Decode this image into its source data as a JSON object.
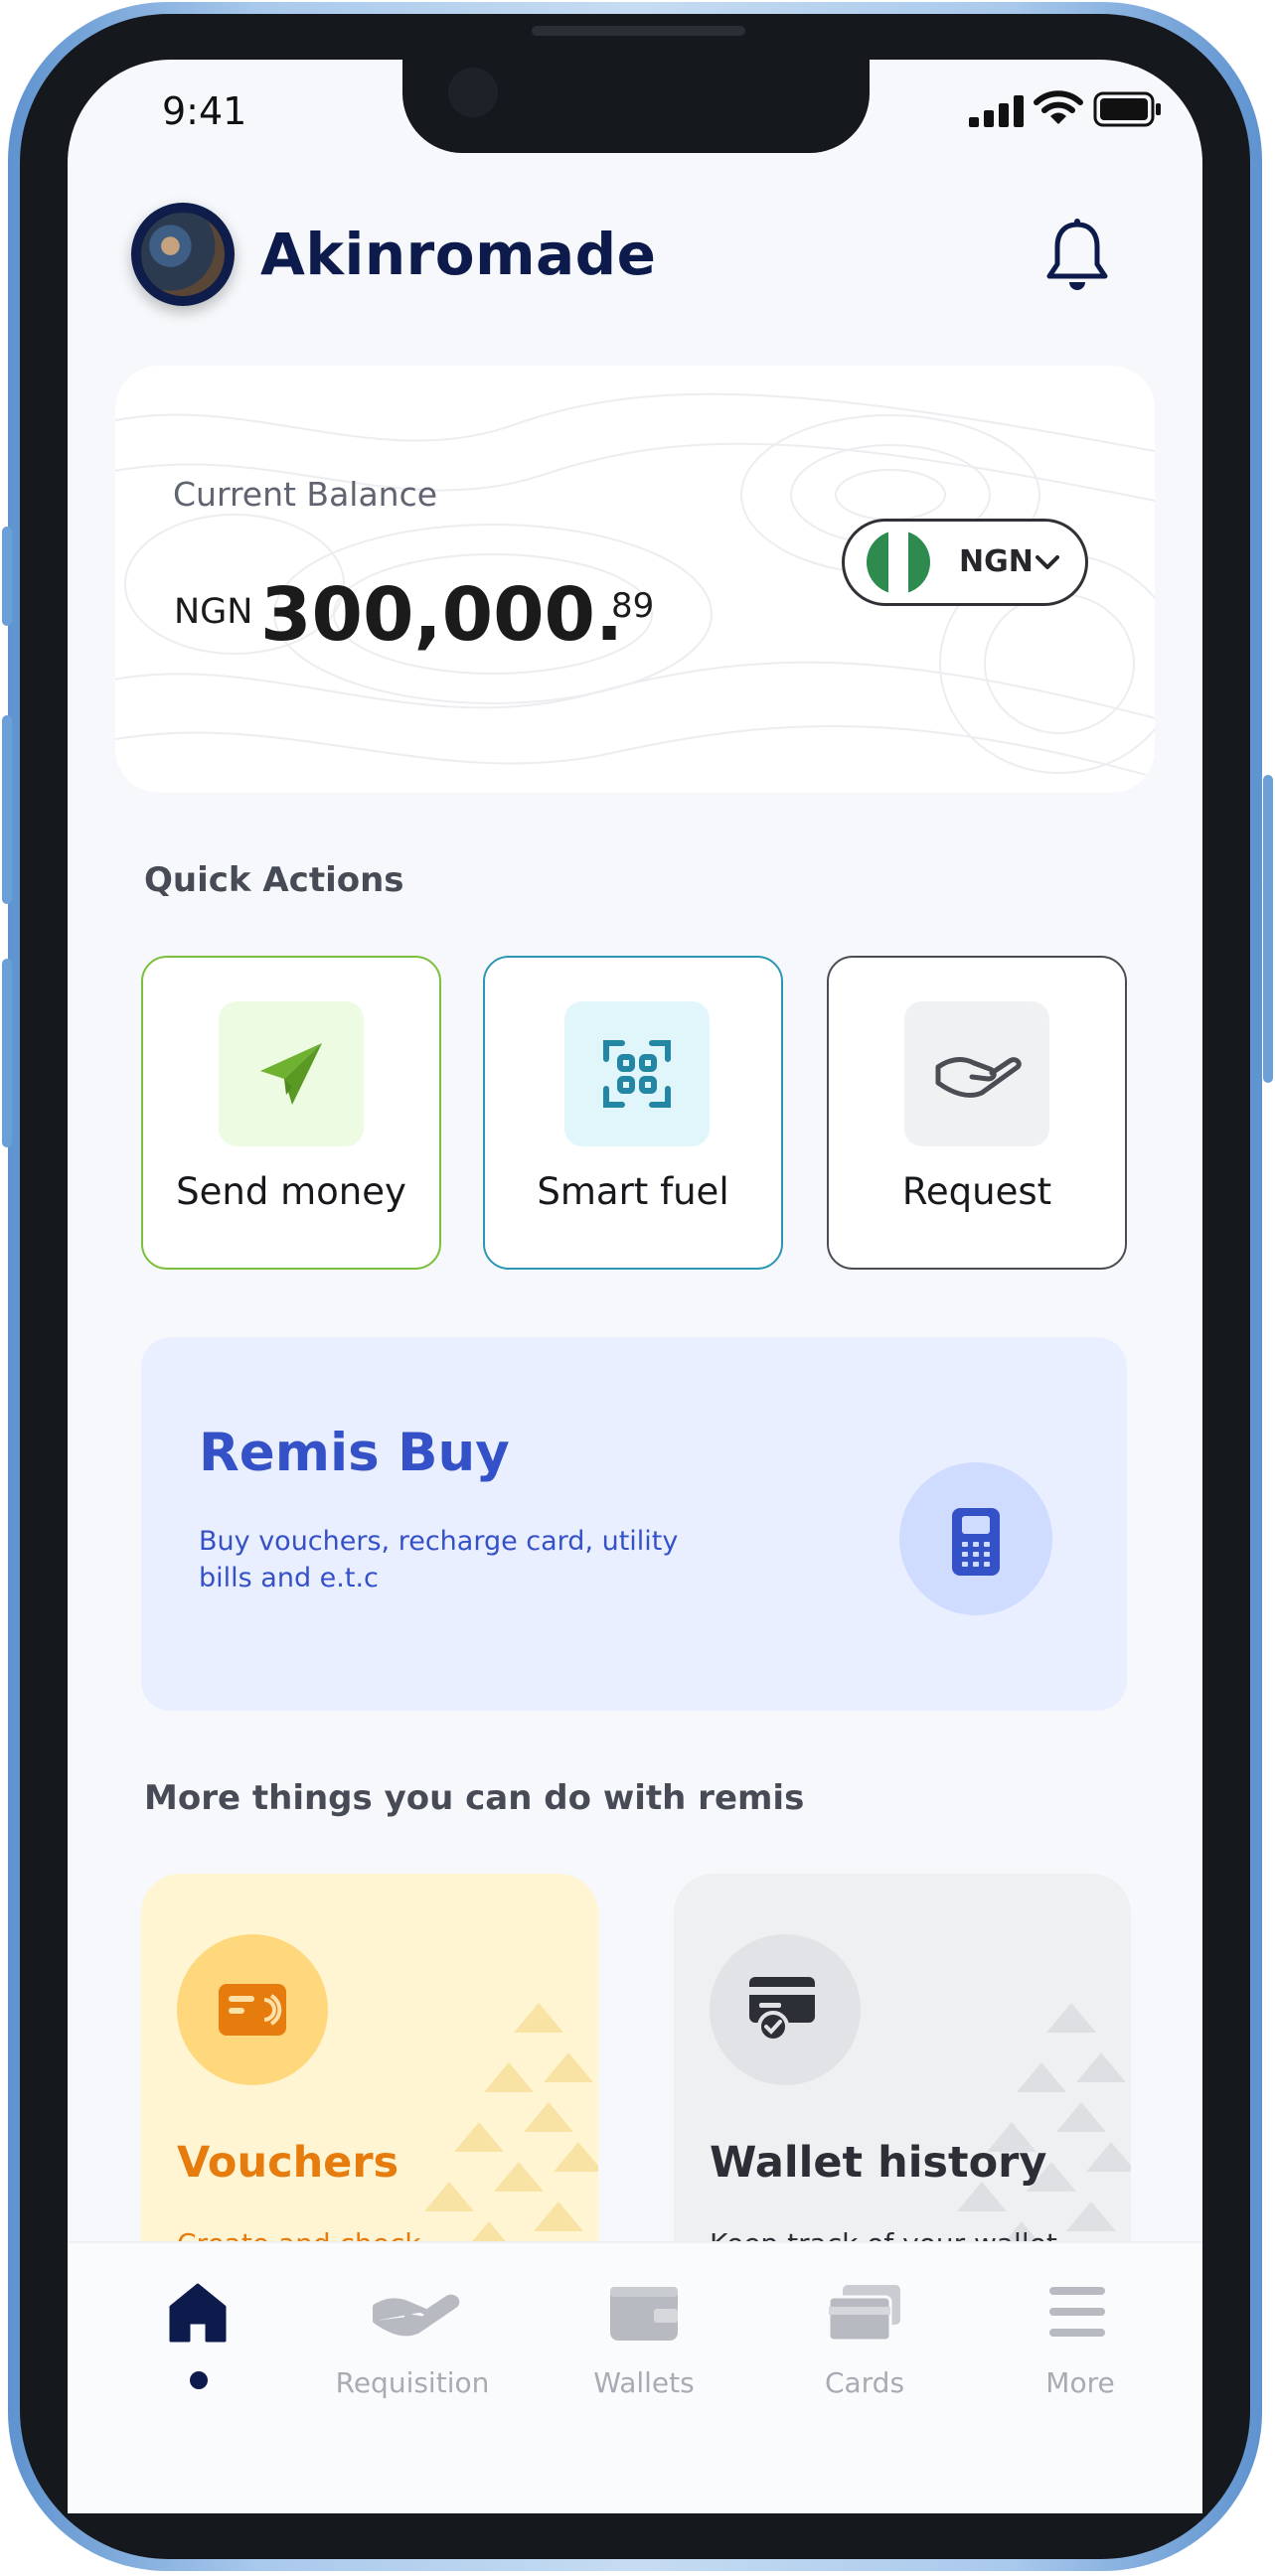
{
  "status_bar": {
    "time": "9:41"
  },
  "header": {
    "username": "Akinromade"
  },
  "balance": {
    "label": "Current Balance",
    "currency_prefix": "NGN",
    "amount_main": "300,000.",
    "amount_decimal": "89",
    "currency_selector": "NGN"
  },
  "quick_actions": {
    "title": "Quick Actions",
    "items": [
      {
        "label": "Send money",
        "accent": "#7cbf3c",
        "icon": "paper-plane-icon"
      },
      {
        "label": "Smart fuel",
        "accent": "#2b97b5",
        "icon": "qr-scan-icon"
      },
      {
        "label": "Request",
        "accent": "#4a4d54",
        "icon": "hand-request-icon"
      }
    ]
  },
  "remis_buy": {
    "title": "Remis Buy",
    "description": "Buy vouchers, recharge card, utility bills and e.t.c",
    "icon": "pos-terminal-icon"
  },
  "more": {
    "title": "More things you can do with remis",
    "cards": [
      {
        "title": "Vouchers",
        "subtitle": "Create and check",
        "icon": "voucher-card-icon",
        "color": "#e77c0e"
      },
      {
        "title": "Wallet history",
        "subtitle": "Keep track of your wallet",
        "icon": "wallet-history-icon",
        "color": "#2c3036"
      }
    ]
  },
  "bottom_nav": {
    "items": [
      {
        "label": "",
        "icon": "home-icon",
        "active": true
      },
      {
        "label": "Requisition",
        "icon": "hand-icon"
      },
      {
        "label": "Wallets",
        "icon": "wallet-icon"
      },
      {
        "label": "Cards",
        "icon": "cards-icon"
      },
      {
        "label": "More",
        "icon": "menu-icon"
      }
    ]
  },
  "colors": {
    "primary": "#0d1b4c",
    "remis_blue": "#3551c8",
    "send_green": "#7cbf3c",
    "fuel_teal": "#2b97b5",
    "voucher_orange": "#e77c0e"
  }
}
